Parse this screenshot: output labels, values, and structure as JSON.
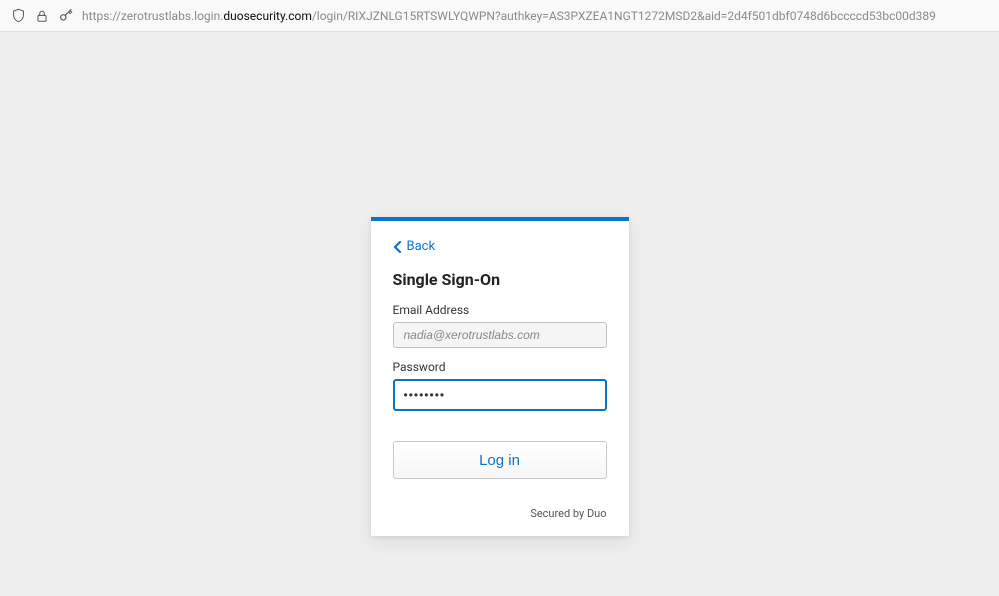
{
  "browser": {
    "url_prefix": "https://zerotrustlabs.login.",
    "url_domain": "duosecurity.com",
    "url_suffix": "/login/RIXJZNLG15RTSWLYQWPN?authkey=AS3PXZEA1NGT1272MSD2&aid=2d4f501dbf0748d6bccccd53bc00d389"
  },
  "card": {
    "back_label": "Back",
    "title": "Single Sign-On",
    "email_label": "Email Address",
    "email_value": "nadia@xerotrustlabs.com",
    "password_label": "Password",
    "password_value": "••••••••",
    "login_button": "Log in",
    "secured_by": "Secured by Duo"
  }
}
